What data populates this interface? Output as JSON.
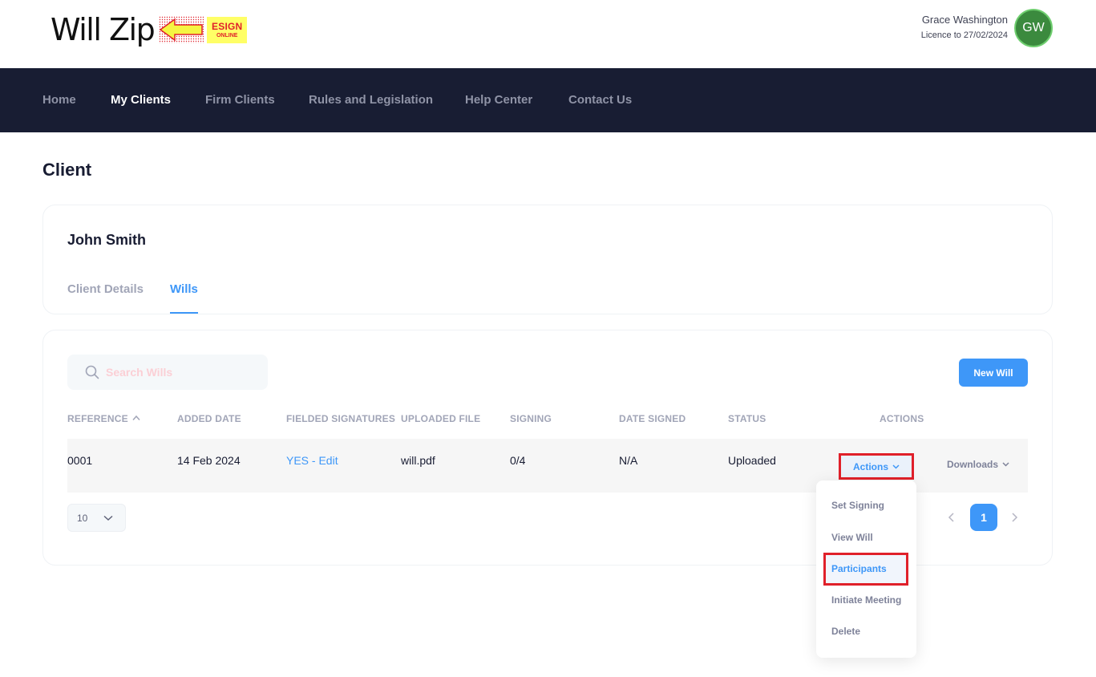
{
  "brand": {
    "logo_text": "Will Zip",
    "badge_top": "ESIGN",
    "badge_bottom": "ONLINE",
    "arrow_icon": "left-arrow-icon",
    "arrow_color": "#f5f542"
  },
  "user": {
    "name": "Grace Washington",
    "licence": "Licence to 27/02/2024",
    "initials": "GW",
    "avatar_color": "#3b8a3e"
  },
  "nav": {
    "items": [
      {
        "label": "Home"
      },
      {
        "label": "My Clients"
      },
      {
        "label": "Firm Clients"
      },
      {
        "label": "Rules and Legislation"
      },
      {
        "label": "Help Center"
      },
      {
        "label": "Contact Us"
      }
    ],
    "active": "My Clients"
  },
  "page": {
    "title": "Client"
  },
  "client": {
    "name": "John Smith",
    "tabs": [
      {
        "label": "Client Details"
      },
      {
        "label": "Wills"
      }
    ],
    "active_tab": "Wills"
  },
  "wills": {
    "search_placeholder": "Search Wills",
    "new_button": "New Will",
    "columns": [
      "REFERENCE",
      "ADDED DATE",
      "FIELDED SIGNATURES",
      "UPLOADED FILE",
      "SIGNING",
      "DATE SIGNED",
      "STATUS",
      "ACTIONS"
    ],
    "rows": [
      {
        "reference": "0001",
        "added_date": "14 Feb 2024",
        "fielded_signatures": "YES - Edit",
        "uploaded_file": "will.pdf",
        "signing": "0/4",
        "date_signed": "N/A",
        "status": "Uploaded",
        "actions_label": "Actions",
        "downloads_label": "Downloads"
      }
    ],
    "page_size": "10",
    "current_page": "1"
  },
  "actions_menu": {
    "items": [
      {
        "label": "Set Signing"
      },
      {
        "label": "View Will"
      },
      {
        "label": "Participants"
      },
      {
        "label": "Initiate Meeting"
      },
      {
        "label": "Delete"
      }
    ],
    "highlighted": "Participants"
  },
  "colors": {
    "accent": "#3e97f8",
    "nav_bg": "#181d33",
    "highlight_border": "#e0202a"
  }
}
